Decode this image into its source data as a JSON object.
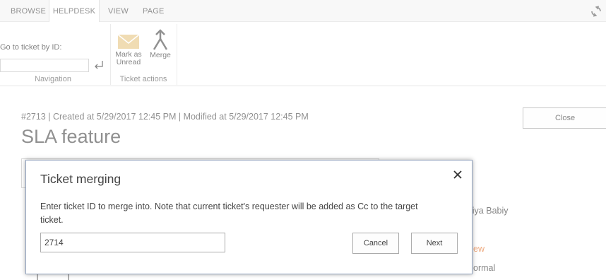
{
  "ribbon": {
    "tabs": [
      {
        "label": "BROWSE",
        "active": false
      },
      {
        "label": "HELPDESK",
        "active": true
      },
      {
        "label": "VIEW",
        "active": false
      },
      {
        "label": "PAGE",
        "active": false
      }
    ],
    "navigation": {
      "goto_label": "Go to ticket by ID:",
      "goto_value": "",
      "group_label": "Navigation"
    },
    "ticket_actions": {
      "mark_unread_label_1": "Mark as",
      "mark_unread_label_2": "Unread",
      "merge_label": "Merge",
      "group_label": "Ticket actions"
    }
  },
  "ticket": {
    "meta": "#2713 | Created at 5/29/2017 12:45 PM | Modified at 5/29/2017 12:45 PM",
    "title": "SLA feature",
    "close_label": "Close",
    "side_requester": "liya Babiy",
    "side_status": "ew",
    "side_priority": "ormal"
  },
  "dialog": {
    "title": "Ticket merging",
    "message": "Enter ticket ID to merge into. Note that current ticket's requester will be added as Cc to the target ticket.",
    "input_value": "2714",
    "cancel_label": "Cancel",
    "next_label": "Next"
  },
  "colors": {
    "mail_icon": "#e8c98a",
    "status_orange": "#e57c3b",
    "dialog_border": "#93a4c0"
  },
  "icons": [
    "sync-icon",
    "enter-icon",
    "envelope-icon",
    "merge-icon",
    "close-icon"
  ]
}
